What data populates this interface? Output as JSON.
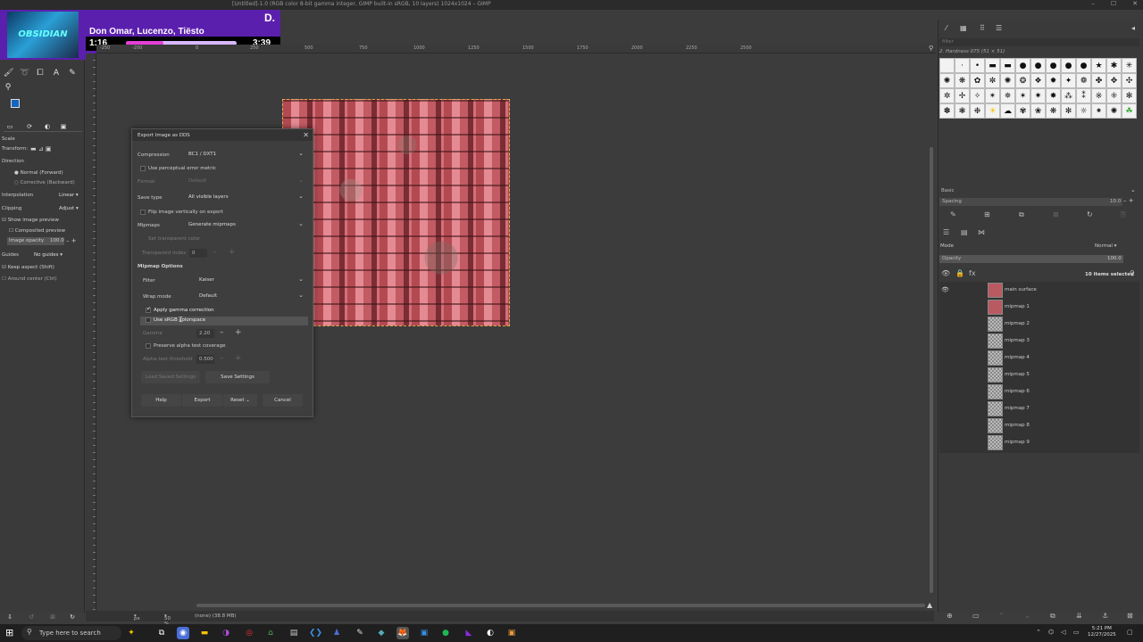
{
  "window": {
    "title": "[Untitled]-1.0 (RGB color 8-bit gamma integer, GIMP built-in sRGB, 10 layers) 1024x1024 – GIMP",
    "controls": [
      "–",
      "☐",
      "✕"
    ]
  },
  "music": {
    "title": "Don Omar, Lucenzo, Tiësto",
    "badge": "D.",
    "current_time": "1:16",
    "total_time": "3:39",
    "progress": 0.34,
    "art_text": "OBSIDIAN"
  },
  "toolbox": {
    "scale_label": "Scale",
    "transform_label": "Transform:",
    "direction_label": "Direction",
    "direction_options": [
      "Normal (Forward)",
      "Corrective (Backward)"
    ],
    "interpolation_label": "Interpolation",
    "interpolation_value": "Linear",
    "clipping_label": "Clipping",
    "clipping_value": "Adjust",
    "show_preview": "Show image preview",
    "composited_preview": "Composited preview",
    "image_opacity_label": "Image opacity",
    "image_opacity_value": "100.0",
    "guides_label": "Guides",
    "guides_value": "No guides",
    "keep_aspect": "Keep aspect (Shift)",
    "around_center": "Around center (Ctrl)"
  },
  "ruler": {
    "ticks": [
      "-250",
      "-200",
      "0",
      "250",
      "500",
      "750",
      "1000",
      "1250",
      "1500",
      "1750",
      "2000",
      "2250",
      "2500"
    ]
  },
  "statusbar": {
    "unit": "px",
    "zoom": "50 %",
    "info": "(none) (38.8 MB)"
  },
  "dialog": {
    "title": "Export Image as DDS",
    "compression_label": "Compression",
    "compression_value": "BC1 / DXT1",
    "perceptual_label": "Use perceptual error metric",
    "format_label": "Format",
    "format_value": "Default",
    "save_type_label": "Save type",
    "save_type_value": "All visible layers",
    "flip_label": "Flip image vertically on export",
    "mipmaps_label": "Mipmaps",
    "mipmaps_value": "Generate mipmaps",
    "transparent_color_label": "Set transparent color",
    "transparent_index_label": "Transparent index",
    "transparent_index_value": "0",
    "mipmap_options_label": "Mipmap Options",
    "filter_label": "Filter",
    "filter_value": "Kaiser",
    "wrap_label": "Wrap mode",
    "wrap_value": "Default",
    "gamma_correction_label": "Apply gamma correction",
    "srgb_label": "Use sRGB colorspace",
    "gamma_label": "Gamma",
    "gamma_value": "2.20",
    "preserve_alpha_label": "Preserve alpha test coverage",
    "alpha_threshold_label": "Alpha test threshold",
    "alpha_threshold_value": "0.500",
    "load_saved_label": "Load Saved Settings",
    "save_settings_label": "Save Settings",
    "help_label": "Help",
    "export_label": "Export",
    "reset_label": "Reset",
    "cancel_label": "Cancel"
  },
  "brushes": {
    "filter_placeholder": "filter",
    "current": "2. Hardness 075 (51 × 51)",
    "preset_label": "Basic",
    "spacing_label": "Spacing",
    "spacing_value": "10.0"
  },
  "layers": {
    "mode_label": "Mode",
    "mode_value": "Normal",
    "opacity_label": "Opacity",
    "opacity_value": "100.0",
    "selected_count": "10 items selected",
    "items": [
      {
        "name": "main surface",
        "thumb": "red"
      },
      {
        "name": "mipmap 1",
        "thumb": "red"
      },
      {
        "name": "mipmap 2",
        "thumb": "checker"
      },
      {
        "name": "mipmap 3",
        "thumb": "checker"
      },
      {
        "name": "mipmap 4",
        "thumb": "checker"
      },
      {
        "name": "mipmap 5",
        "thumb": "checker"
      },
      {
        "name": "mipmap 6",
        "thumb": "checker"
      },
      {
        "name": "mipmap 7",
        "thumb": "checker"
      },
      {
        "name": "mipmap 8",
        "thumb": "checker"
      },
      {
        "name": "mipmap 9",
        "thumb": "checker"
      }
    ]
  },
  "taskbar": {
    "search_placeholder": "Type here to search",
    "time": "5:21 PM",
    "date": "12/27/2025"
  },
  "colors": {
    "accent_purple": "#5b1fae",
    "progress_pink": "#e53fd9",
    "fg_color": "#1565c0"
  }
}
